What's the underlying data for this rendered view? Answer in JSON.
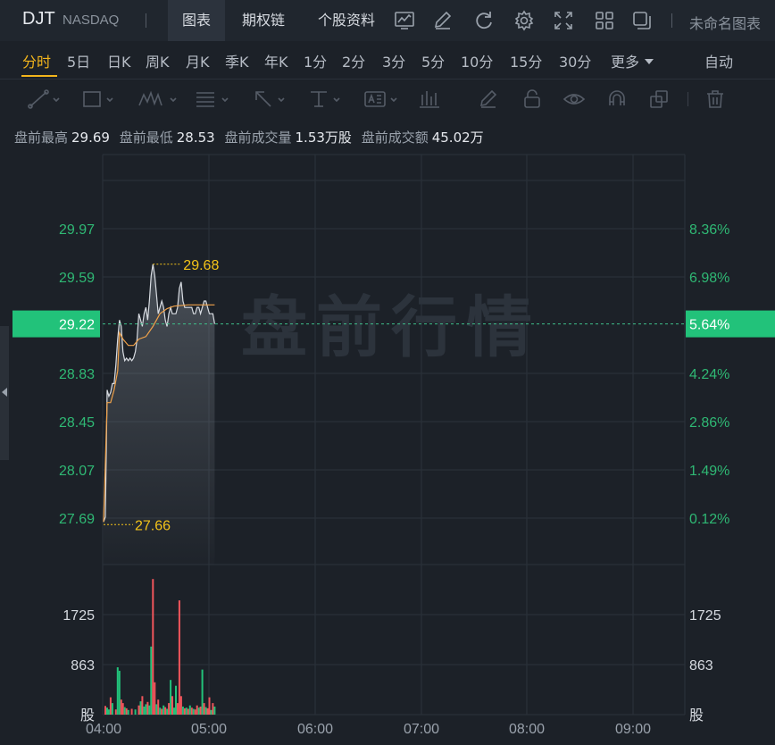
{
  "header": {
    "ticker": "DJT",
    "exchange": "NASDAQ",
    "tabs": [
      "图表",
      "期权链",
      "个股资料"
    ],
    "active_tab": "图表",
    "chart_name": "未命名图表",
    "icons": [
      "indicator-icon",
      "draw-pen-icon",
      "refresh-icon",
      "settings-icon",
      "fullscreen-icon",
      "layout-grid-icon",
      "window-icon"
    ]
  },
  "periods": {
    "items": [
      "分时",
      "5日",
      "日K",
      "周K",
      "月K",
      "季K",
      "年K",
      "1分",
      "2分",
      "3分",
      "5分",
      "10分",
      "15分",
      "30分",
      "更多"
    ],
    "active": "分时",
    "auto_label": "自动"
  },
  "stats": {
    "high_label": "盘前最高",
    "high": "29.69",
    "low_label": "盘前最低",
    "low": "28.53",
    "volume_label": "盘前成交量",
    "volume": "1.53万股",
    "amount_label": "盘前成交额",
    "amount": "45.02万"
  },
  "watermark": "盘前行情",
  "chart_data": {
    "type": "line",
    "price_axis": {
      "ticks": [
        "29.97",
        "29.59",
        "28.83",
        "28.45",
        "28.07",
        "27.69"
      ],
      "ylim": [
        27.69,
        29.97
      ],
      "current": "29.22"
    },
    "pct_axis": {
      "ticks": [
        "8.36%",
        "6.98%",
        "4.24%",
        "2.86%",
        "1.49%",
        "0.12%"
      ],
      "current": "5.64%"
    },
    "volume_axis": {
      "ticks": [
        "1725",
        "863"
      ],
      "unit": "股",
      "ylim": [
        0,
        2600
      ]
    },
    "time_axis": {
      "ticks": [
        "04:00",
        "05:00",
        "06:00",
        "07:00",
        "08:00",
        "09:00"
      ]
    },
    "annotations": {
      "high": "29.68",
      "low": "27.66"
    },
    "price_series": [
      [
        0,
        27.66
      ],
      [
        1,
        27.7
      ],
      [
        2,
        28.7
      ],
      [
        3,
        28.65
      ],
      [
        4,
        28.68
      ],
      [
        5,
        28.75
      ],
      [
        6,
        28.75
      ],
      [
        7,
        28.9
      ],
      [
        8,
        29.1
      ],
      [
        9,
        29.25
      ],
      [
        10,
        29.2
      ],
      [
        11,
        29.0
      ],
      [
        12,
        28.93
      ],
      [
        13,
        28.95
      ],
      [
        14,
        28.93
      ],
      [
        15,
        28.95
      ],
      [
        16,
        28.93
      ],
      [
        17,
        28.95
      ],
      [
        18,
        29.0
      ],
      [
        19,
        29.1
      ],
      [
        20,
        29.3
      ],
      [
        21,
        29.25
      ],
      [
        22,
        29.2
      ],
      [
        23,
        29.3
      ],
      [
        24,
        29.35
      ],
      [
        25,
        29.25
      ],
      [
        26,
        29.4
      ],
      [
        27,
        29.6
      ],
      [
        28,
        29.69
      ],
      [
        29,
        29.6
      ],
      [
        30,
        29.45
      ],
      [
        31,
        29.3
      ],
      [
        32,
        29.35
      ],
      [
        33,
        29.4
      ],
      [
        34,
        29.35
      ],
      [
        35,
        29.25
      ],
      [
        36,
        29.2
      ],
      [
        37,
        29.3
      ],
      [
        38,
        29.35
      ],
      [
        39,
        29.3
      ],
      [
        40,
        29.3
      ],
      [
        41,
        29.3
      ],
      [
        42,
        29.35
      ],
      [
        43,
        29.5
      ],
      [
        44,
        29.55
      ],
      [
        45,
        29.4
      ],
      [
        46,
        29.35
      ],
      [
        47,
        29.35
      ],
      [
        48,
        29.35
      ],
      [
        49,
        29.35
      ],
      [
        50,
        29.35
      ],
      [
        51,
        29.3
      ],
      [
        52,
        29.3
      ],
      [
        53,
        29.35
      ],
      [
        54,
        29.35
      ],
      [
        55,
        29.3
      ],
      [
        56,
        29.35
      ],
      [
        57,
        29.4
      ],
      [
        58,
        29.4
      ],
      [
        59,
        29.35
      ],
      [
        60,
        29.3
      ],
      [
        61,
        29.3
      ],
      [
        62,
        29.3
      ],
      [
        63,
        29.22
      ]
    ],
    "avg_series": [
      [
        0,
        27.66
      ],
      [
        2,
        28.6
      ],
      [
        4,
        28.6
      ],
      [
        6,
        28.7
      ],
      [
        8,
        28.85
      ],
      [
        9,
        29.15
      ],
      [
        11,
        29.1
      ],
      [
        14,
        29.05
      ],
      [
        17,
        29.05
      ],
      [
        20,
        29.1
      ],
      [
        24,
        29.12
      ],
      [
        28,
        29.2
      ],
      [
        32,
        29.3
      ],
      [
        36,
        29.34
      ],
      [
        40,
        29.36
      ],
      [
        48,
        29.37
      ],
      [
        56,
        29.37
      ],
      [
        63,
        29.37
      ]
    ],
    "volume_bars": [
      {
        "t": 1,
        "v": 150,
        "c": "red"
      },
      {
        "t": 2,
        "v": 120,
        "c": "green"
      },
      {
        "t": 3,
        "v": 90,
        "c": "green"
      },
      {
        "t": 4,
        "v": 300,
        "c": "red"
      },
      {
        "t": 5,
        "v": 200,
        "c": "green"
      },
      {
        "t": 7,
        "v": 90,
        "c": "red"
      },
      {
        "t": 8,
        "v": 820,
        "c": "green"
      },
      {
        "t": 9,
        "v": 760,
        "c": "green"
      },
      {
        "t": 10,
        "v": 260,
        "c": "red"
      },
      {
        "t": 11,
        "v": 200,
        "c": "red"
      },
      {
        "t": 12,
        "v": 130,
        "c": "green"
      },
      {
        "t": 13,
        "v": 110,
        "c": "red"
      },
      {
        "t": 14,
        "v": 80,
        "c": "green"
      },
      {
        "t": 16,
        "v": 100,
        "c": "red"
      },
      {
        "t": 18,
        "v": 90,
        "c": "green"
      },
      {
        "t": 20,
        "v": 160,
        "c": "red"
      },
      {
        "t": 21,
        "v": 230,
        "c": "green"
      },
      {
        "t": 22,
        "v": 320,
        "c": "red"
      },
      {
        "t": 23,
        "v": 140,
        "c": "green"
      },
      {
        "t": 24,
        "v": 180,
        "c": "green"
      },
      {
        "t": 25,
        "v": 220,
        "c": "red"
      },
      {
        "t": 26,
        "v": 160,
        "c": "green"
      },
      {
        "t": 27,
        "v": 1180,
        "c": "green"
      },
      {
        "t": 28,
        "v": 2350,
        "c": "red"
      },
      {
        "t": 29,
        "v": 560,
        "c": "red"
      },
      {
        "t": 30,
        "v": 180,
        "c": "green"
      },
      {
        "t": 31,
        "v": 260,
        "c": "red"
      },
      {
        "t": 32,
        "v": 120,
        "c": "green"
      },
      {
        "t": 33,
        "v": 100,
        "c": "red"
      },
      {
        "t": 34,
        "v": 160,
        "c": "green"
      },
      {
        "t": 35,
        "v": 130,
        "c": "red"
      },
      {
        "t": 36,
        "v": 100,
        "c": "green"
      },
      {
        "t": 37,
        "v": 200,
        "c": "red"
      },
      {
        "t": 38,
        "v": 600,
        "c": "green"
      },
      {
        "t": 39,
        "v": 320,
        "c": "red"
      },
      {
        "t": 40,
        "v": 120,
        "c": "green"
      },
      {
        "t": 41,
        "v": 500,
        "c": "green"
      },
      {
        "t": 42,
        "v": 200,
        "c": "red"
      },
      {
        "t": 43,
        "v": 1980,
        "c": "red"
      },
      {
        "t": 44,
        "v": 320,
        "c": "red"
      },
      {
        "t": 45,
        "v": 140,
        "c": "green"
      },
      {
        "t": 46,
        "v": 110,
        "c": "red"
      },
      {
        "t": 47,
        "v": 120,
        "c": "green"
      },
      {
        "t": 48,
        "v": 100,
        "c": "red"
      },
      {
        "t": 49,
        "v": 160,
        "c": "green"
      },
      {
        "t": 50,
        "v": 120,
        "c": "red"
      },
      {
        "t": 51,
        "v": 100,
        "c": "green"
      },
      {
        "t": 52,
        "v": 90,
        "c": "red"
      },
      {
        "t": 53,
        "v": 160,
        "c": "red"
      },
      {
        "t": 54,
        "v": 120,
        "c": "green"
      },
      {
        "t": 55,
        "v": 140,
        "c": "red"
      },
      {
        "t": 56,
        "v": 780,
        "c": "green"
      },
      {
        "t": 57,
        "v": 200,
        "c": "red"
      },
      {
        "t": 58,
        "v": 130,
        "c": "green"
      },
      {
        "t": 59,
        "v": 110,
        "c": "red"
      },
      {
        "t": 60,
        "v": 300,
        "c": "red"
      },
      {
        "t": 61,
        "v": 80,
        "c": "green"
      },
      {
        "t": 62,
        "v": 200,
        "c": "red"
      },
      {
        "t": 63,
        "v": 140,
        "c": "green"
      }
    ]
  },
  "colors": {
    "up": "#f0555b",
    "down": "#22c27a",
    "price_line": "#d8dce2",
    "avg_line": "#f0a24a",
    "label_yellow": "#f3c319",
    "axis_green": "#2fb874"
  }
}
